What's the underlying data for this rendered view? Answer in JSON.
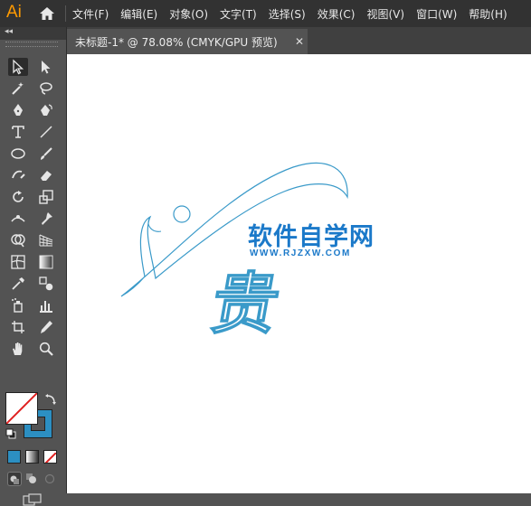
{
  "app": {
    "logo_text": "Ai"
  },
  "menu": {
    "items": [
      "文件(F)",
      "编辑(E)",
      "对象(O)",
      "文字(T)",
      "选择(S)",
      "效果(C)",
      "视图(V)",
      "窗口(W)",
      "帮助(H)"
    ]
  },
  "toolbar": {
    "collapse_label": "◂◂"
  },
  "document": {
    "tab_title": "未标题-1* @ 78.08% (CMYK/GPU 预览)",
    "close_glyph": "✕"
  },
  "artwork": {
    "stroke_color": "#3a9ac9",
    "watermark_title": "软件自学网",
    "watermark_url": "WWW.RJZXW.COM",
    "watermark_color": "#1b79c9",
    "outline_char": "贵"
  },
  "colors": {
    "menubar_bg": "#323232",
    "panel_bg": "#535353",
    "logo_orange": "#ff9a00",
    "stroke_swatch": "#2c8fc2",
    "none_red": "#e02020"
  }
}
